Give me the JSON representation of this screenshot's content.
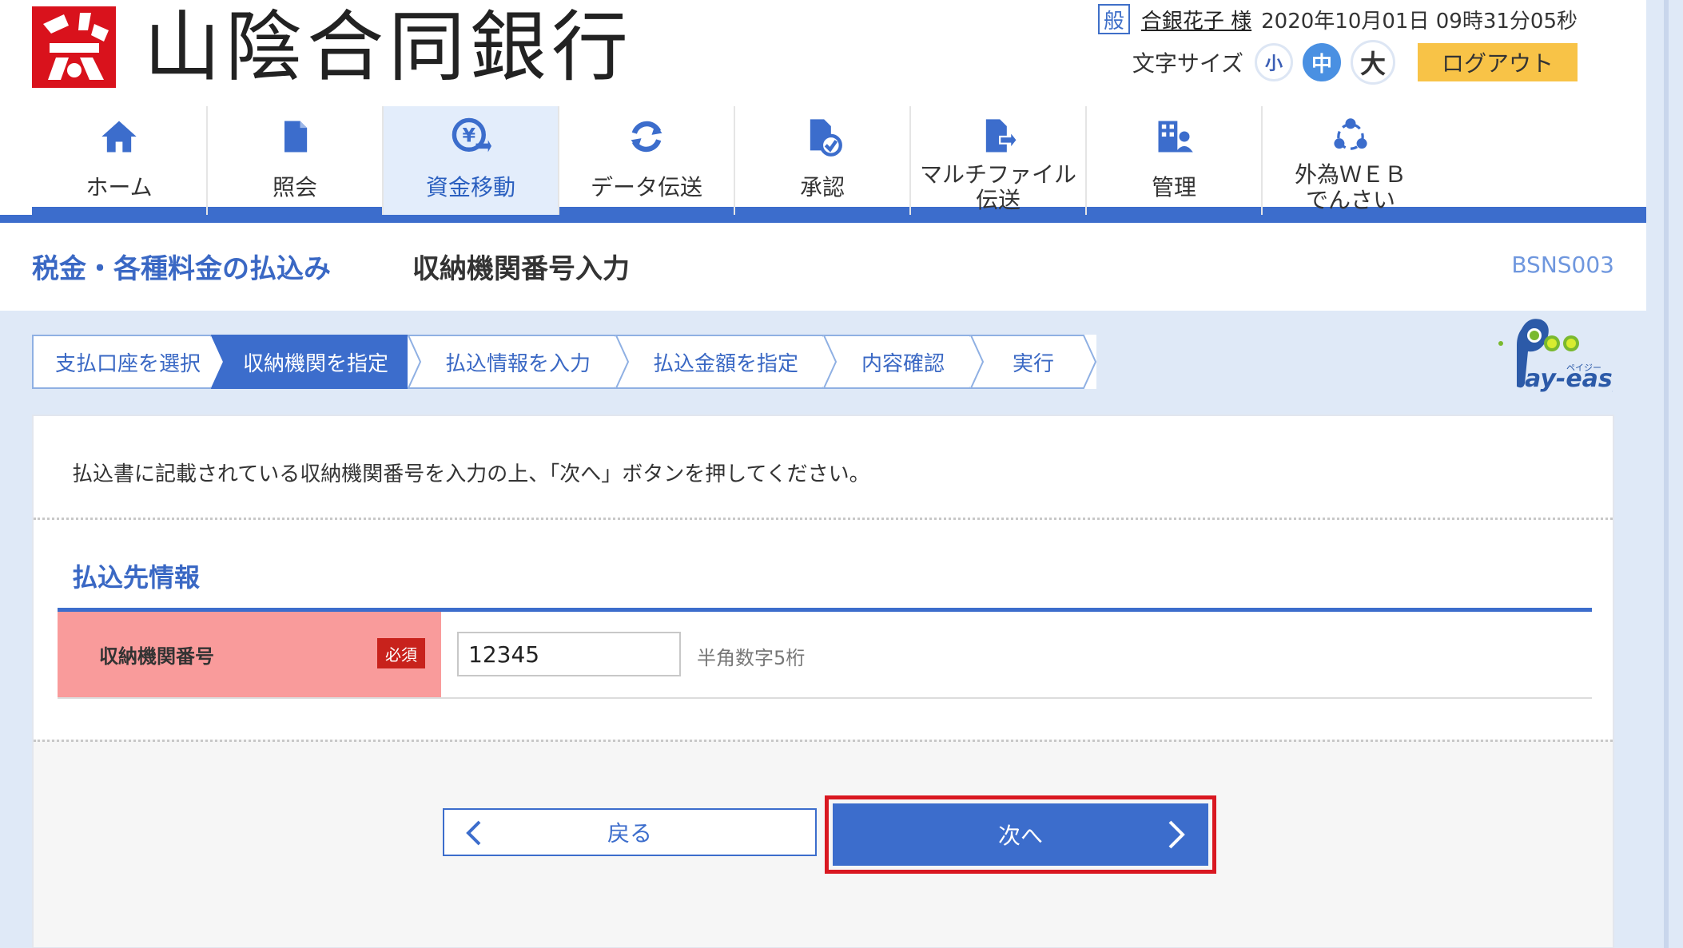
{
  "header": {
    "bank_name": "山陰合同銀行",
    "user_type_badge": "般",
    "user_name": "合銀花子 様",
    "datetime": "2020年10月01日 09時31分05秒",
    "font_size_label": "文字サイズ",
    "font_size_options": [
      "小",
      "中",
      "大"
    ],
    "font_size_selected": "中",
    "logout_label": "ログアウト"
  },
  "nav": {
    "items": [
      {
        "label": "ホーム",
        "icon": "home-icon"
      },
      {
        "label": "照会",
        "icon": "document-icon"
      },
      {
        "label": "資金移動",
        "icon": "yen-transfer-icon"
      },
      {
        "label": "データ伝送",
        "icon": "sync-icon"
      },
      {
        "label": "承認",
        "icon": "approve-document-icon"
      },
      {
        "label": "マルチファイル\n伝送",
        "icon": "file-upload-icon"
      },
      {
        "label": "管理",
        "icon": "admin-building-icon"
      },
      {
        "label": "外為ＷＥＢ\nでんさい",
        "icon": "forex-network-icon"
      }
    ],
    "active": "資金移動"
  },
  "title_bar": {
    "section_title": "税金・各種料金の払込み",
    "page_title": "収納機関番号入力",
    "screen_id": "BSNS003"
  },
  "steps": [
    "支払口座を選択",
    "収納機関を指定",
    "払込情報を入力",
    "払込金額を指定",
    "内容確認",
    "実行"
  ],
  "active_step": "収納機関を指定",
  "payeasy_logo": {
    "brand": "Pay-easy",
    "kana": "ペイジー"
  },
  "main": {
    "instruction": "払込書に記載されている収納機関番号を入力の上、「次へ」ボタンを押してください。",
    "section_heading": "払込先情報",
    "form": {
      "label": "収納機関番号",
      "required_badge": "必須",
      "value": "12345",
      "hint": "半角数字5桁"
    },
    "back_label": "戻る",
    "next_label": "次へ"
  },
  "colors": {
    "accent_blue": "#3c6dcc",
    "logo_red": "#d9121c",
    "logout_yellow": "#f8c347",
    "required_red": "#c8221c",
    "label_pink": "#f99b9b",
    "highlight_red": "#d91821"
  }
}
